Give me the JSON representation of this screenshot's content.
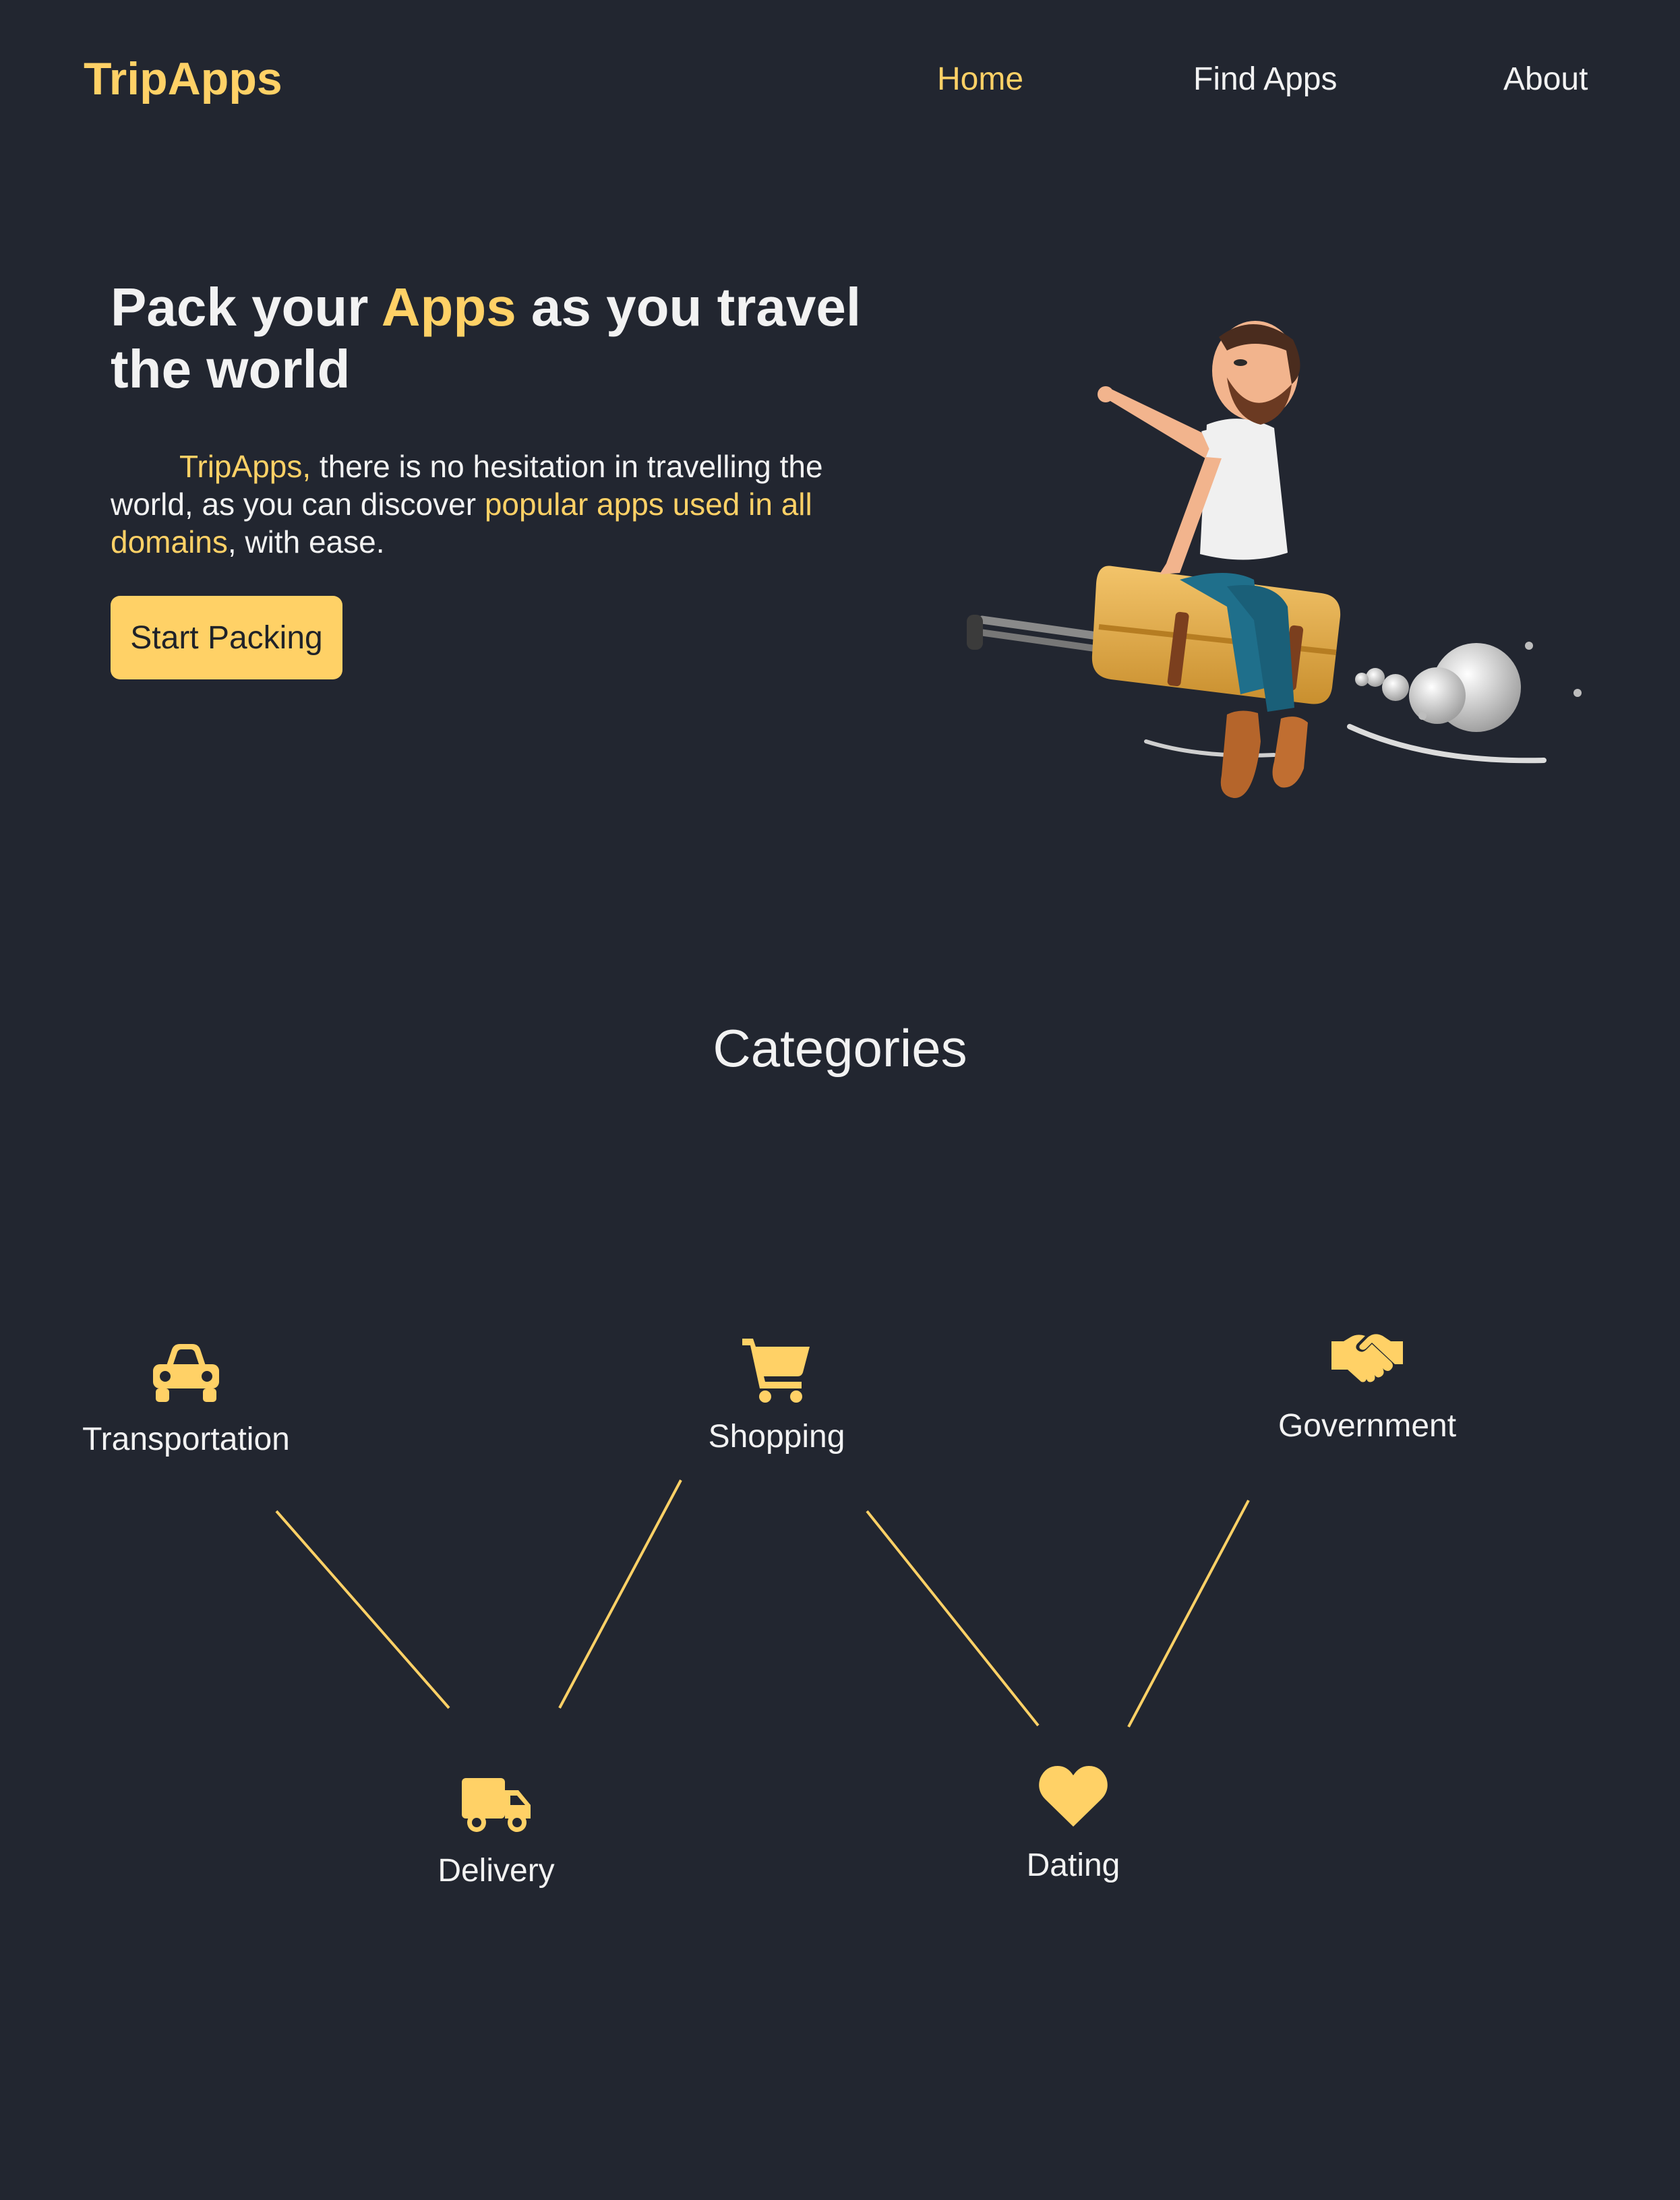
{
  "header": {
    "logo": "TripApps",
    "nav": [
      {
        "label": "Home",
        "active": true
      },
      {
        "label": "Find Apps",
        "active": false
      },
      {
        "label": "About",
        "active": false
      }
    ]
  },
  "hero": {
    "title_part1": "Pack your ",
    "title_accent": "Apps",
    "title_part2": " as you travel the world",
    "desc_accent1": "TripApps,",
    "desc_text1": " there is no hesitation in travelling the world, as you can discover ",
    "desc_accent2": "popular apps used in all domains",
    "desc_text2": ", with ease.",
    "cta_label": "Start Packing",
    "illustration_icon": "man-riding-suitcase-illustration"
  },
  "categories": {
    "title": "Categories",
    "items": [
      {
        "label": "Transportation",
        "icon": "car-icon"
      },
      {
        "label": "Shopping",
        "icon": "shopping-cart-icon"
      },
      {
        "label": "Government",
        "icon": "handshake-icon"
      },
      {
        "label": "Delivery",
        "icon": "truck-icon"
      },
      {
        "label": "Dating",
        "icon": "heart-icon"
      }
    ]
  },
  "colors": {
    "background": "#222630",
    "accent": "#ffd166",
    "text": "#f2f2f2"
  }
}
